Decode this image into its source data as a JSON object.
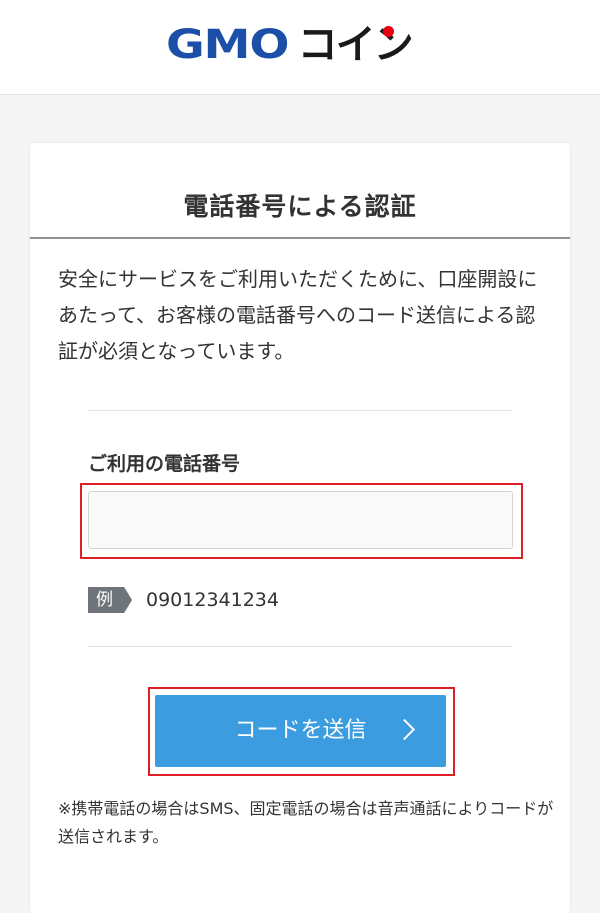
{
  "brand": {
    "logo_latin": "GMO",
    "logo_kana": "コイン",
    "color_blue": "#1b4fa8",
    "color_black": "#1a1a1a",
    "color_red": "#e60012",
    "logo_icon": "gmo-coin-logo-icon"
  },
  "card": {
    "title": "電話番号による認証",
    "description": "安全にサービスをご利用いただくために、口座開設にあたって、お客様の電話番号へのコード送信による認証が必須となっています。"
  },
  "phone_field": {
    "label": "ご利用の電話番号",
    "value": "",
    "placeholder": ""
  },
  "example": {
    "badge": "例",
    "value": "09012341234"
  },
  "send_button": {
    "label": "コードを送信",
    "icon": "chevron-right-icon",
    "color": "#3b9de0"
  },
  "note": "※携帯電話の場合はSMS、固定電話の場合は音声通話によりコードが送信されます。",
  "highlight_color": "#dd1f26"
}
